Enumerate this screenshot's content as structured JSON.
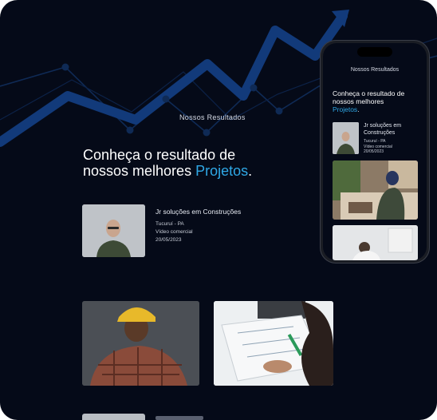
{
  "section": {
    "tag": "Nossos Resultados"
  },
  "headline": {
    "line1": "Conheça o resultado de",
    "line2_prefix": "nossos melhores ",
    "accent": "Projetos",
    "suffix": "."
  },
  "project": {
    "title": "Jr soluções em Construções",
    "location": "Tucuruí - PA",
    "type": "Vídeo comercial",
    "date": "20/05/2023"
  },
  "mobile": {
    "tag": "Nossos Resultados",
    "headline_line1": "Conheça o resultado de",
    "headline_line2": "nossos melhores",
    "accent": "Projetos",
    "suffix": ".",
    "project_title": "Jr soluções em Construções",
    "location": "Tucuruí - PA",
    "type": "Vídeo comercial",
    "date": "20/05/2023"
  },
  "colors": {
    "background": "#050a18",
    "accent": "#2fa8e6",
    "chart": "#0f2d63"
  }
}
